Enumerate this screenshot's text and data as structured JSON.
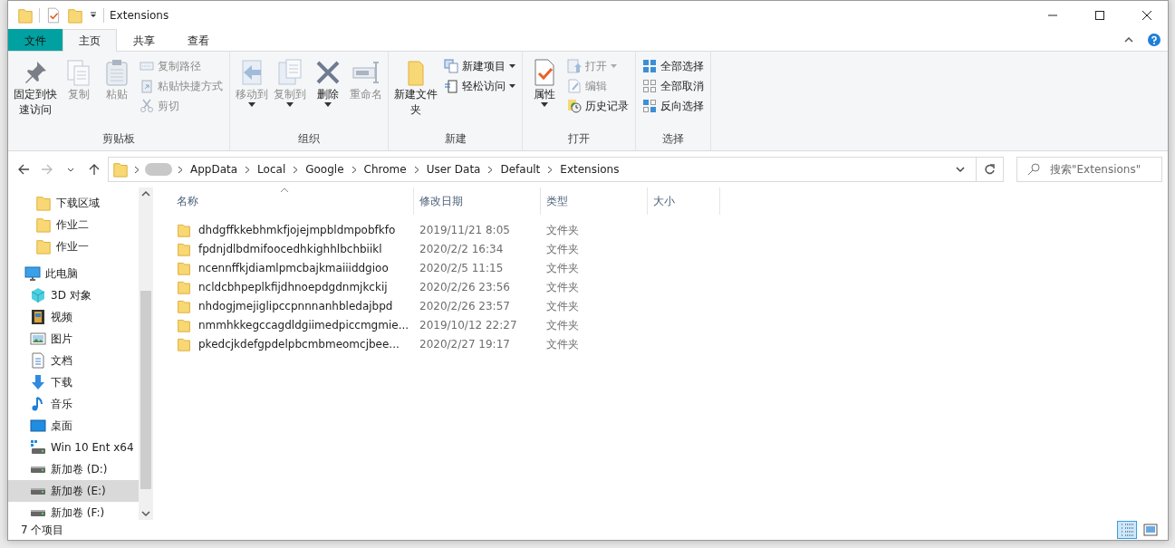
{
  "window": {
    "title": "Extensions"
  },
  "ribbon_tabs": [
    {
      "label": "文件",
      "kind": "file",
      "selected": false
    },
    {
      "label": "主页",
      "kind": "tab",
      "selected": true
    },
    {
      "label": "共享",
      "kind": "tab",
      "selected": false
    },
    {
      "label": "查看",
      "kind": "tab",
      "selected": false
    }
  ],
  "ribbon_groups": [
    {
      "label": "剪贴板",
      "commands": [
        {
          "label": "固定到快速访问",
          "kind": "large",
          "disabled": false,
          "dropdown": false
        },
        {
          "label": "复制",
          "kind": "large",
          "disabled": true,
          "dropdown": false
        },
        {
          "label": "粘贴",
          "kind": "large",
          "disabled": true,
          "dropdown": false
        },
        {
          "label": "复制路径",
          "kind": "small",
          "disabled": true,
          "dropdown": false
        },
        {
          "label": "粘贴快捷方式",
          "kind": "small",
          "disabled": true,
          "dropdown": false
        },
        {
          "label": "剪切",
          "kind": "small",
          "disabled": true,
          "dropdown": false
        }
      ]
    },
    {
      "label": "组织",
      "commands": [
        {
          "label": "移动到",
          "kind": "large",
          "disabled": true,
          "dropdown": true
        },
        {
          "label": "复制到",
          "kind": "large",
          "disabled": true,
          "dropdown": true
        },
        {
          "label": "删除",
          "kind": "large",
          "disabled": false,
          "dropdown": true
        },
        {
          "label": "重命名",
          "kind": "large",
          "disabled": true,
          "dropdown": false
        }
      ]
    },
    {
      "label": "新建",
      "commands": [
        {
          "label": "新建文件夹",
          "kind": "large",
          "disabled": false,
          "dropdown": false
        },
        {
          "label": "新建项目",
          "kind": "small",
          "disabled": false,
          "dropdown": true
        },
        {
          "label": "轻松访问",
          "kind": "small",
          "disabled": false,
          "dropdown": true
        }
      ]
    },
    {
      "label": "打开",
      "commands": [
        {
          "label": "属性",
          "kind": "large",
          "disabled": false,
          "dropdown": true
        },
        {
          "label": "打开",
          "kind": "small",
          "disabled": true,
          "dropdown": true
        },
        {
          "label": "编辑",
          "kind": "small",
          "disabled": true,
          "dropdown": false
        },
        {
          "label": "历史记录",
          "kind": "small",
          "disabled": false,
          "dropdown": false
        }
      ]
    },
    {
      "label": "选择",
      "commands": [
        {
          "label": "全部选择",
          "kind": "small",
          "disabled": false,
          "dropdown": false
        },
        {
          "label": "全部取消",
          "kind": "small",
          "disabled": false,
          "dropdown": false
        },
        {
          "label": "反向选择",
          "kind": "small",
          "disabled": false,
          "dropdown": false
        }
      ]
    }
  ],
  "address_bar": {
    "crumbs": [
      "AppData",
      "Local",
      "Google",
      "Chrome",
      "User Data",
      "Default",
      "Extensions"
    ]
  },
  "search": {
    "placeholder": "搜索\"Extensions\""
  },
  "navigation": [
    {
      "label": "下载区域",
      "kind": "folder",
      "selected": false
    },
    {
      "label": "作业二",
      "kind": "folder",
      "selected": false
    },
    {
      "label": "作业一",
      "kind": "folder",
      "selected": false
    },
    {
      "label": "此电脑",
      "kind": "pc",
      "selected": false,
      "children": [
        {
          "label": "3D 对象",
          "kind": "cube",
          "selected": false
        },
        {
          "label": "视频",
          "kind": "film",
          "selected": false
        },
        {
          "label": "图片",
          "kind": "image",
          "selected": false
        },
        {
          "label": "文档",
          "kind": "doc",
          "selected": false
        },
        {
          "label": "下载",
          "kind": "download",
          "selected": false
        },
        {
          "label": "音乐",
          "kind": "music",
          "selected": false
        },
        {
          "label": "桌面",
          "kind": "desktop",
          "selected": false
        },
        {
          "label": "Win 10 Ent x64",
          "kind": "windrive",
          "selected": false
        },
        {
          "label": "新加卷 (D:)",
          "kind": "drive",
          "selected": false
        },
        {
          "label": "新加卷 (E:)",
          "kind": "drive",
          "selected": true
        },
        {
          "label": "新加卷 (F:)",
          "kind": "drive",
          "selected": false
        }
      ]
    }
  ],
  "file_list": {
    "columns": [
      "名称",
      "修改日期",
      "类型",
      "大小"
    ],
    "rows": [
      {
        "name": "dhdgffkkebhmkfjojejmpbldmpobfkfo",
        "modified": "2019/11/21 8:05",
        "type": "文件夹"
      },
      {
        "name": "fpdnjdlbdmifoocedhkighhlbchbiikl",
        "modified": "2020/2/2 16:34",
        "type": "文件夹"
      },
      {
        "name": "ncennffkjdiamlpmcbajkmaiiiddgioo",
        "modified": "2020/2/5 11:15",
        "type": "文件夹"
      },
      {
        "name": "ncldcbhpeplkfijdhnoepdgdnmjkckij",
        "modified": "2020/2/26 23:56",
        "type": "文件夹"
      },
      {
        "name": "nhdogjmejiglipccpnnnanhbledajbpd",
        "modified": "2020/2/26 23:57",
        "type": "文件夹"
      },
      {
        "name": "nmmhkkegccagdldgiimedpiccmgmie...",
        "modified": "2019/10/12 22:27",
        "type": "文件夹"
      },
      {
        "name": "pkedcjkdefgpdelpbcmbmeomcjbee...",
        "modified": "2020/2/27 19:17",
        "type": "文件夹"
      }
    ]
  },
  "status_bar": {
    "count": "7 个项目",
    "views": [
      {
        "kind": "details",
        "selected": true
      },
      {
        "kind": "large_icons",
        "selected": false
      }
    ]
  }
}
